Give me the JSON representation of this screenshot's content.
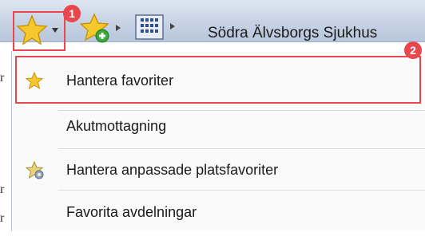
{
  "toolbar": {
    "location_label": "Södra Älvsborgs Sjukhus",
    "badge_1": "1",
    "icons": [
      "star-icon",
      "star-add-icon",
      "building-icon"
    ]
  },
  "menu": {
    "badge_2": "2",
    "items": [
      {
        "label": "Hantera favoriter",
        "icon": "star-icon"
      },
      {
        "label": "Akutmottagning",
        "icon": ""
      },
      {
        "label": "Hantera anpassade platsfavoriter",
        "icon": "star-settings-icon"
      },
      {
        "label": "Favorita avdelningar",
        "icon": ""
      }
    ]
  },
  "background_glyphs": [
    "r",
    "r",
    "r"
  ],
  "colors": {
    "highlight": "#e8474d",
    "toolbar_top": "#dfe6f1",
    "toolbar_bottom": "#b9c7dc",
    "star": "#f6c82d"
  }
}
